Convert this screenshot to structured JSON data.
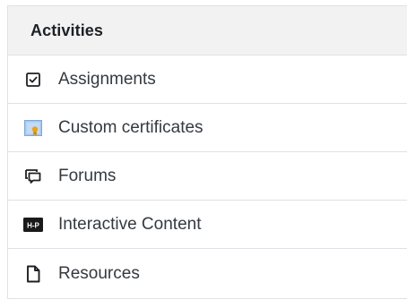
{
  "block": {
    "title": "Activities",
    "items": [
      {
        "label": "Assignments",
        "icon": "checkbox-icon"
      },
      {
        "label": "Custom certificates",
        "icon": "certificate-icon"
      },
      {
        "label": "Forums",
        "icon": "forum-icon"
      },
      {
        "label": "Interactive Content",
        "icon": "h5p-icon",
        "icon_text": "H-P"
      },
      {
        "label": "Resources",
        "icon": "document-icon"
      }
    ]
  },
  "colors": {
    "header_bg": "#f2f2f2",
    "border": "#dee2e6",
    "text": "#343a40",
    "certificate_blue": "#a9c8ee",
    "certificate_gold": "#e6a417",
    "h5p_bg": "#1a1a1a"
  }
}
